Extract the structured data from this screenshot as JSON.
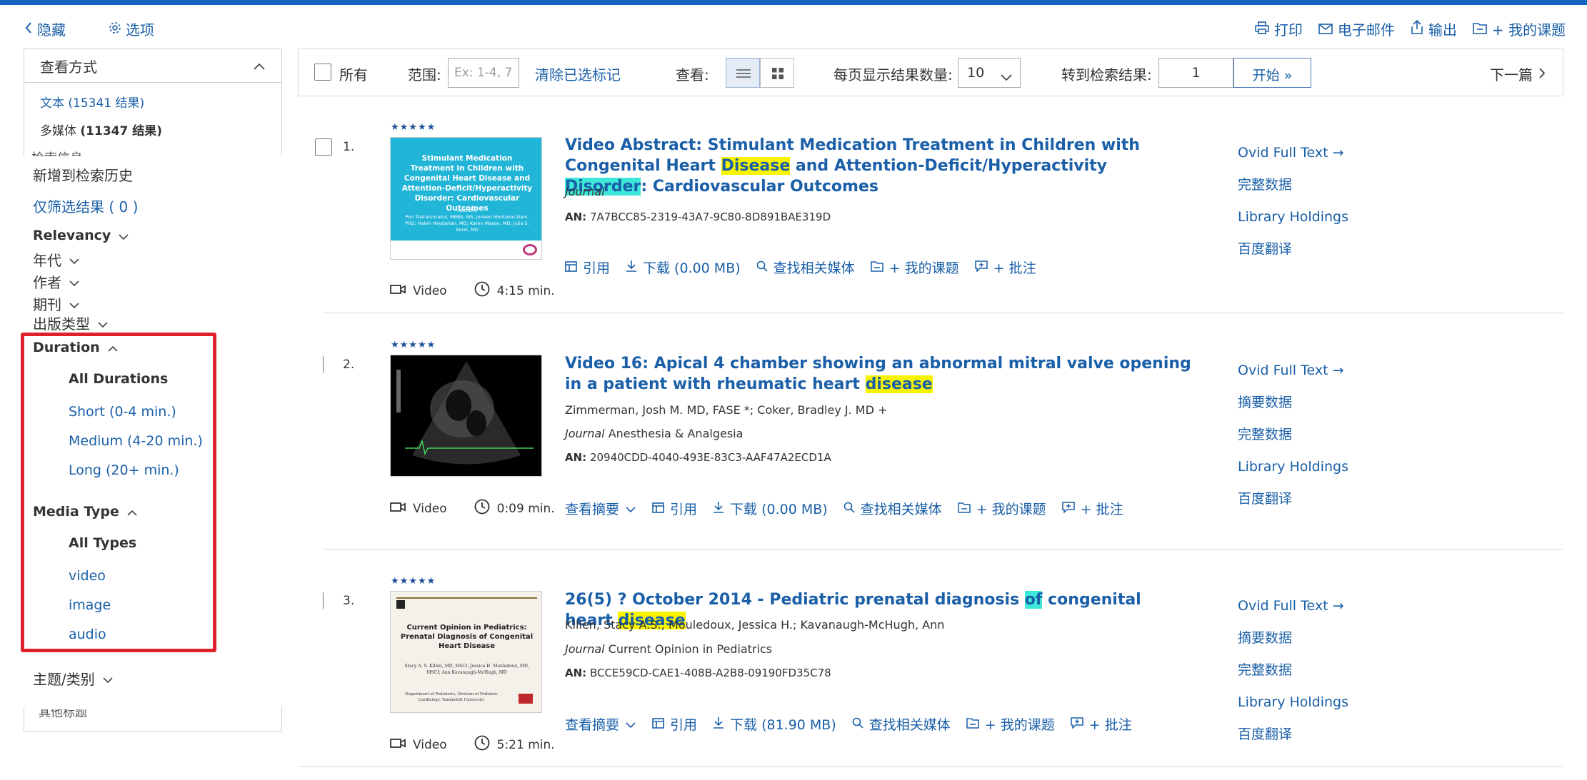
{
  "top": {
    "hide_label": "隐藏",
    "options_label": "选项",
    "print": "打印",
    "email": "电子邮件",
    "export": "输出",
    "my_projects": "+ 我的课题"
  },
  "view_panel": {
    "title": "查看方式",
    "text_item": "文本 (15341 结果)",
    "media_item": "多媒体",
    "media_count": "(11347 结果)",
    "cut_text": "检索信息"
  },
  "sidebar": {
    "add_history": "新增到检索历史",
    "filter_selected": "仅筛选结果 ( 0 )",
    "relevancy": "Relevancy",
    "year": "年代",
    "author": "作者",
    "journal": "期刊",
    "pub_type": "出版类型",
    "duration": "Duration",
    "all_durations": "All Durations",
    "short": "Short (0-4 min.)",
    "medium": "Medium (4-20 min.)",
    "long": "Long (20+ min.)",
    "media_type": "Media Type",
    "all_types": "All Types",
    "video": "video",
    "image": "image",
    "audio": "audio",
    "subject": "主题/类别",
    "cut_bottom": "其他标题"
  },
  "toolbar": {
    "all": "所有",
    "range": "范围:",
    "range_placeholder": "Ex: 1-4, 7",
    "clear": "清除已选标记",
    "view": "查看:",
    "per_page_label": "每页显示结果数量:",
    "per_page_value": "10",
    "goto_label": "转到检索结果:",
    "goto_value": "1",
    "go": "开始 »",
    "next": "下一篇"
  },
  "results": [
    {
      "num": "1.",
      "stars": "★★★★★",
      "title_parts": [
        "Video Abstract: Stimulant Medication Treatment in Children with Congenital Heart ",
        "Disease",
        " and Attention-Deficit/Hyperactivity ",
        "Disorder",
        ": Cardiovascular Outcomes"
      ],
      "authors": "",
      "journal_label": "Journal",
      "journal": "",
      "an_label": "AN:",
      "an": "7A7BCC85-2319-43A7-9C80-8D891BAE319D",
      "thumb_text": "Stimulant Medication Treatment in Children with Congenital Heart Disease and Attention-Deficit/Hyperactivity Disorder: Cardiovascular Outcomes",
      "thumb_authors_label": "Authors",
      "thumb_authors": "Pon Trairatvorakul, MBBS, MS; Jeneen Montalvo-Dam, PhD; Haleh Heydarian, MD; Karen Mason, MD; Julia S. Anixt, MD",
      "cite": "引用",
      "download": "下载 (0.00 MB)",
      "related": "查找相关媒体",
      "project": "+ 我的课题",
      "annotate": "+ 批注",
      "type": "Video",
      "duration": "4:15 min.",
      "links": [
        "Ovid Full Text →",
        "完整数据",
        "Library Holdings",
        "百度翻译"
      ]
    },
    {
      "num": "2.",
      "stars": "★★★★★",
      "title_parts": [
        "Video 16: Apical 4 chamber showing an abnormal mitral valve opening in a patient with rheumatic heart ",
        "disease"
      ],
      "authors": "Zimmerman, Josh M. MD, FASE *; Coker, Bradley J. MD +",
      "journal_label": "Journal",
      "journal": "Anesthesia & Analgesia",
      "an_label": "AN:",
      "an": "20940CDD-4040-493E-83C3-AAF47A2ECD1A",
      "abstract": "查看摘要",
      "cite": "引用",
      "download": "下载 (0.00 MB)",
      "related": "查找相关媒体",
      "project": "+ 我的课题",
      "annotate": "+ 批注",
      "type": "Video",
      "duration": "0:09 min.",
      "links": [
        "Ovid Full Text →",
        "摘要数据",
        "完整数据",
        "Library Holdings",
        "百度翻译"
      ]
    },
    {
      "num": "3.",
      "stars": "★★★★★",
      "title_parts": [
        "26(5) ? October 2014 - Pediatric prenatal diagnosis ",
        "of",
        " congenital heart ",
        "disease"
      ],
      "authors": "Killen, Stacy A.S.; Mouledoux, Jessica H.; Kavanaugh-McHugh, Ann",
      "journal_label": "Journal",
      "journal": "Current Opinion in Pediatrics",
      "an_label": "AN:",
      "an": "BCCE59CD-CAE1-408B-A2B8-09190FD35C78",
      "thumb_title": "Current Opinion in Pediatrics: Prenatal Diagnosis of Congenital Heart Disease",
      "thumb_authors": "Stacy A. S. Killen, MD, MSCI; Jessica H. Mouledoux, MD, MSCI; Ann Kavanaugh-McHugh, MD",
      "thumb_dept": "Department of Pediatrics, Division of Pediatric Cardiology, Vanderbilt University",
      "abstract": "查看摘要",
      "cite": "引用",
      "download": "下载 (81.90 MB)",
      "related": "查找相关媒体",
      "project": "+ 我的课题",
      "annotate": "+ 批注",
      "type": "Video",
      "duration": "5:21 min.",
      "links": [
        "Ovid Full Text →",
        "摘要数据",
        "完整数据",
        "Library Holdings",
        "百度翻译"
      ]
    }
  ]
}
